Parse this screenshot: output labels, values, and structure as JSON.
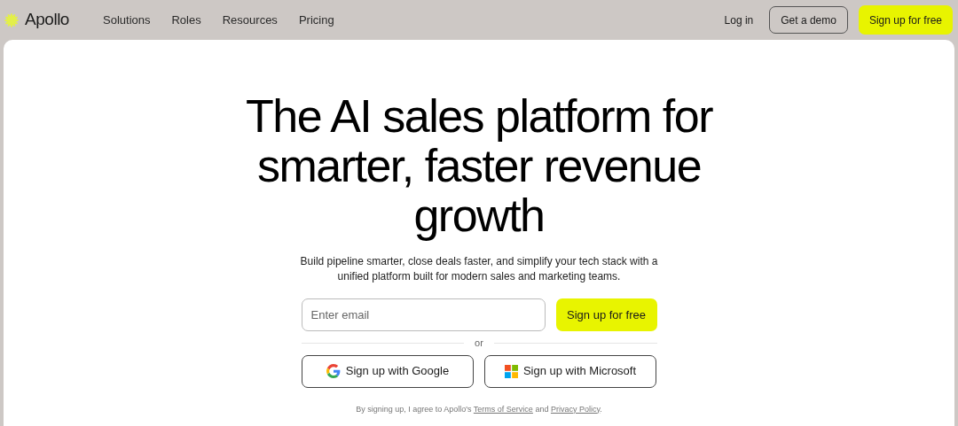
{
  "nav": {
    "logo": "Apollo",
    "links": [
      "Solutions",
      "Roles",
      "Resources",
      "Pricing"
    ],
    "login": "Log in",
    "demo": "Get a demo",
    "signup": "Sign up for free"
  },
  "hero": {
    "title_lines": [
      "The AI sales platform for",
      "smarter, faster revenue",
      "growth"
    ],
    "subtitle": "Build pipeline smarter, close deals faster, and simplify your tech stack with a unified platform built for modern sales and marketing teams.",
    "email": {
      "placeholder": "Enter email"
    },
    "submit": "Sign up for free",
    "divider": "or",
    "providers": [
      {
        "kind": "google",
        "label": "Sign up with Google"
      },
      {
        "kind": "microsoft",
        "label": "Sign up with Microsoft"
      }
    ],
    "legal": {
      "prefix": "By signing up, I agree to Apollo's",
      "terms": "Terms of Service",
      "middle": "and",
      "privacy": "Privacy Policy",
      "suffix": "."
    }
  }
}
